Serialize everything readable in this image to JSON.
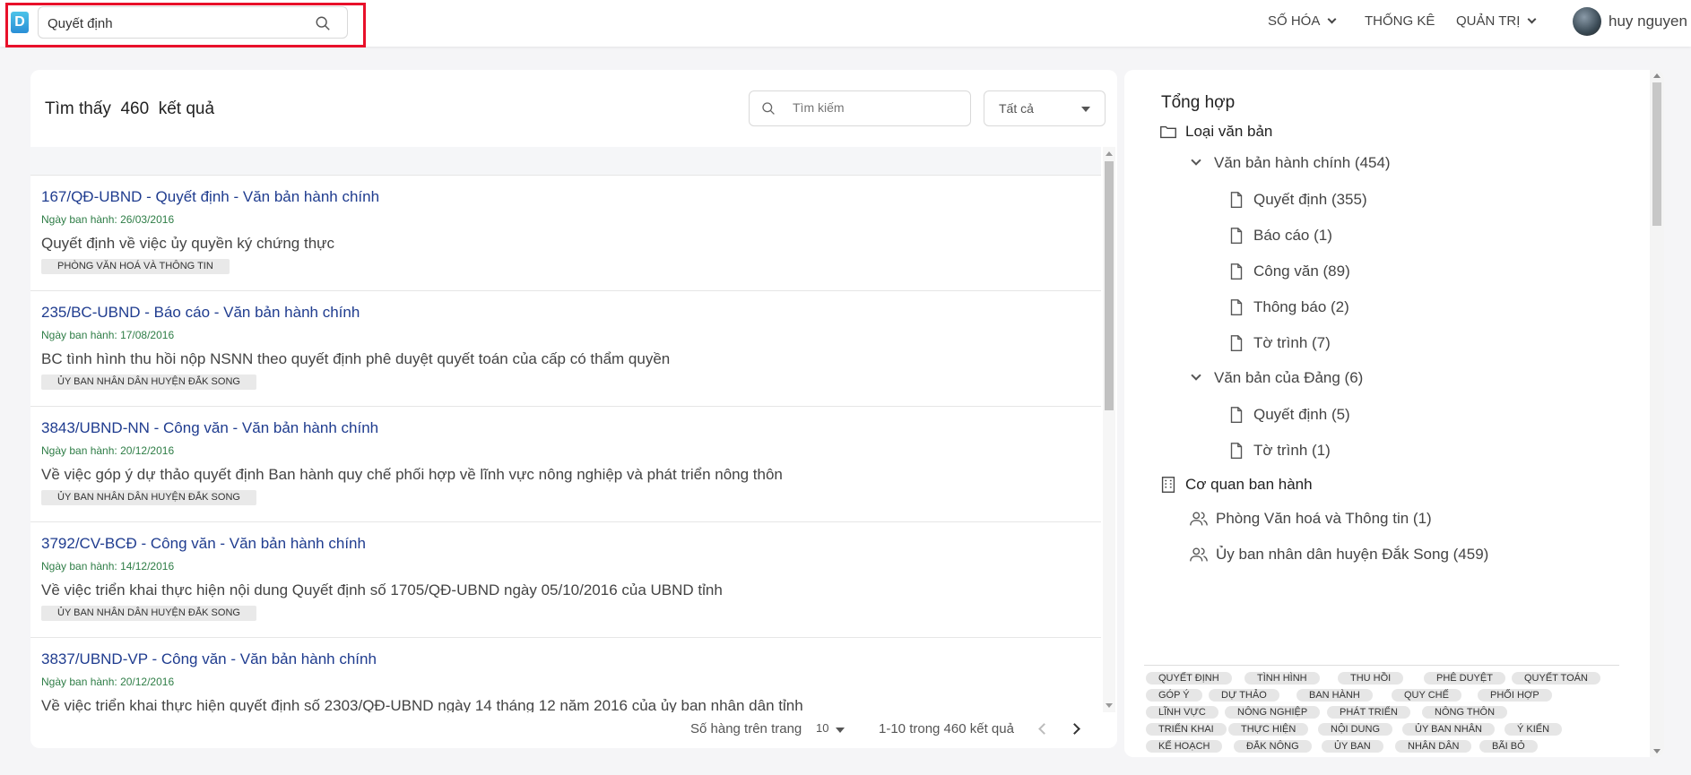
{
  "app": {
    "logo_letter": "D"
  },
  "header": {
    "search_value": "Quyết định",
    "nav": [
      {
        "label": "SỐ HÓA"
      },
      {
        "label": "THỐNG KÊ"
      },
      {
        "label": "QUẢN TRỊ"
      }
    ],
    "user_name": "huy nguyen"
  },
  "results": {
    "title_prefix": "Tìm thấy",
    "count": "460",
    "title_suffix": "kết quả",
    "search_placeholder": "Tìm kiếm",
    "filter_value": "Tất cả",
    "items": [
      {
        "title": "167/QĐ-UBND - Quyết định - Văn bản hành chính",
        "date": "Ngày ban hành: 26/03/2016",
        "desc": "Quyết định về việc ủy quyền ký chứng thực",
        "tag": "PHÒNG VĂN HOÁ VÀ THÔNG TIN"
      },
      {
        "title": "235/BC-UBND - Báo cáo - Văn bản hành chính",
        "date": "Ngày ban hành: 17/08/2016",
        "desc": "BC tình hình thu hồi nộp NSNN theo quyết định phê duyệt quyết toán của cấp có thẩm quyền",
        "tag": "ỦY BAN NHÂN DÂN HUYỆN ĐẮK SONG"
      },
      {
        "title": "3843/UBND-NN - Công văn - Văn bản hành chính",
        "date": "Ngày ban hành: 20/12/2016",
        "desc": "Về việc góp ý dự thảo quyết định Ban hành quy chế phối hợp về lĩnh vực nông nghiệp và phát triển nông thôn",
        "tag": "ỦY BAN NHÂN DÂN HUYỆN ĐẮK SONG"
      },
      {
        "title": "3792/CV-BCĐ - Công văn - Văn bản hành chính",
        "date": "Ngày ban hành: 14/12/2016",
        "desc": "Về việc triển khai thực hiện nội dung Quyết định số 1705/QĐ-UBND ngày 05/10/2016 của UBND tỉnh",
        "tag": "ỦY BAN NHÂN DÂN HUYỆN ĐẮK SONG"
      },
      {
        "title": "3837/UBND-VP - Công văn - Văn bản hành chính",
        "date": "Ngày ban hành: 20/12/2016",
        "desc": "Về việc triển khai thực hiện quyết định số 2303/QĐ-UBND ngày 14 tháng 12 năm 2016 của ủy ban nhân dân tỉnh",
        "tag": ""
      }
    ],
    "pager": {
      "rows_label": "Số hàng trên trang",
      "rows_value": "10",
      "range": "1-10 trong 460 kết quả"
    }
  },
  "summary": {
    "title": "Tổng hợp",
    "doc_type_label": "Loại văn bản",
    "groups": [
      {
        "label": "Văn bản hành chính (454)",
        "children": [
          "Quyết định (355)",
          "Báo cáo (1)",
          "Công văn (89)",
          "Thông báo (2)",
          "Tờ trình (7)"
        ]
      },
      {
        "label": "Văn bản của Đảng (6)",
        "children": [
          "Quyết định (5)",
          "Tờ trình (1)"
        ]
      }
    ],
    "agency_label": "Cơ quan ban hành",
    "agencies": [
      "Phòng Văn hoá và Thông tin (1)",
      "Ủy ban nhân dân huyện Đắk Song (459)"
    ],
    "keywords": [
      [
        "QUYẾT ĐỊNH",
        "TÌNH HÌNH",
        "THU HỒI",
        "PHÊ DUYỆT",
        "QUYẾT TOÁN"
      ],
      [
        "GÓP Ý",
        "DỰ THẢO",
        "BAN HÀNH",
        "QUY CHẾ",
        "PHỐI HỢP"
      ],
      [
        "LĨNH VỰC",
        "NÔNG NGHIỆP",
        "PHÁT TRIỂN",
        "NÔNG THÔN"
      ],
      [
        "TRIỂN KHAI",
        "THỰC HIỆN",
        "NỘI DUNG",
        "ỦY BAN NHÂN",
        "Ý KIẾN"
      ],
      [
        "KẾ HOẠCH",
        "ĐẮK NÔNG",
        "ỦY BAN",
        "NHÂN DÂN",
        "BÃI BỎ"
      ]
    ]
  }
}
